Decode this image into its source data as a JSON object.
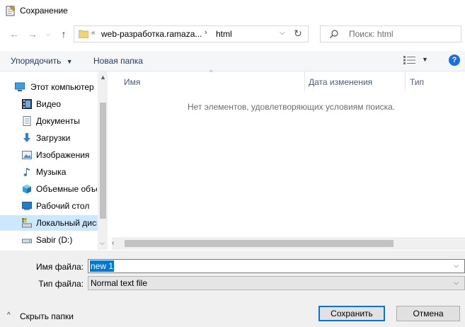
{
  "window": {
    "title": "Сохранение"
  },
  "address": {
    "overflow": "«",
    "part1": "web-разработка.ramaza...",
    "separator": "›",
    "part2": "html"
  },
  "search": {
    "placeholder": "Поиск: html"
  },
  "toolbar": {
    "organize": "Упорядочить",
    "new_folder": "Новая папка",
    "help": "?"
  },
  "nav": {
    "items": [
      {
        "label": "Этот компьютер",
        "icon": "computer-icon"
      },
      {
        "label": "Видео",
        "icon": "video-icon"
      },
      {
        "label": "Документы",
        "icon": "documents-icon"
      },
      {
        "label": "Загрузки",
        "icon": "downloads-icon"
      },
      {
        "label": "Изображения",
        "icon": "pictures-icon"
      },
      {
        "label": "Музыка",
        "icon": "music-icon"
      },
      {
        "label": "Объемные объекты",
        "icon": "3d-objects-icon"
      },
      {
        "label": "Рабочий стол",
        "icon": "desktop-icon"
      },
      {
        "label": "Локальный диск (C:)",
        "icon": "local-disk-icon"
      },
      {
        "label": "Sabir (D:)",
        "icon": "drive-icon"
      }
    ]
  },
  "filelist": {
    "columns": [
      "Имя",
      "Дата изменения",
      "Тип"
    ],
    "empty_message": "Нет элементов, удовлетворяющих условиям поиска."
  },
  "form": {
    "filename_label": "Имя файла:",
    "filename_value": "new 1",
    "filetype_label": "Тип файла:",
    "filetype_value": "Normal text file"
  },
  "footer": {
    "hide_folders": "Скрыть папки",
    "save": "Сохранить",
    "cancel": "Отмена"
  },
  "colors": {
    "accent": "#0078d7",
    "selection": "#cce8ff"
  }
}
